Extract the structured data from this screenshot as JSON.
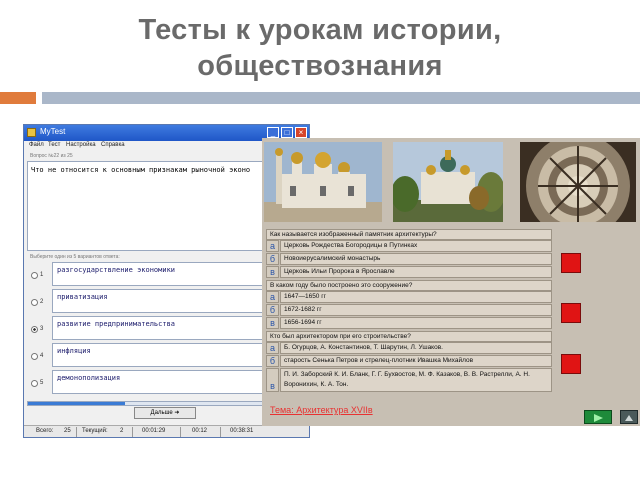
{
  "slide": {
    "title_line1": "Тесты к урокам истории,",
    "title_line2": "обществознания"
  },
  "mytest": {
    "window_title": "MyTest",
    "menu": [
      "Файл",
      "Тест",
      "Настройка",
      "Справка"
    ],
    "question_counter": "Вопрос №22 из 25",
    "question_text": "Что не относится к основным признакам рыночной эконо",
    "choose_prompt": "Выберите один из 5 вариантов ответа:",
    "answers": [
      {
        "num": "1",
        "text": "разгосударствление экономики"
      },
      {
        "num": "2",
        "text": "приватизация"
      },
      {
        "num": "3",
        "text": "развитие предпринимательства"
      },
      {
        "num": "4",
        "text": "инфляция"
      },
      {
        "num": "5",
        "text": "демонополизация"
      }
    ],
    "selected_answer": 3,
    "progress_fraction": 0.35,
    "next_button": "Дальше",
    "status": {
      "total_label": "Всего:",
      "total_value": "25",
      "current_label": "Текущий:",
      "current_value": "2",
      "time1": "00:01:29",
      "time2": "00:12",
      "time3": "00:38:31"
    }
  },
  "architecture_test": {
    "questions": [
      {
        "question": "Как называется изображенный памятник архитектуры?",
        "options": [
          {
            "letter": "а",
            "text": "Церковь Рождества Богородицы в Путинках"
          },
          {
            "letter": "б",
            "text": "Новоиерусалимский монастырь"
          },
          {
            "letter": "в",
            "text": "Церковь Ильи Пророка в Ярославле"
          }
        ]
      },
      {
        "question": "В каком году было построено это сооружение?",
        "options": [
          {
            "letter": "а",
            "text": "1647—1650 гг"
          },
          {
            "letter": "б",
            "text": "1672-1682 гг"
          },
          {
            "letter": "в",
            "text": "1656-1694 гг"
          }
        ]
      },
      {
        "question": "Кто был архитектором при его строительстве?",
        "options": [
          {
            "letter": "а",
            "text": "Б. Огурцов, А. Константинов, Т. Шарутин, Л. Ушаков."
          },
          {
            "letter": "б",
            "text": "старость Сенька Петров и стрелец-плотник Ивашка Михайлов"
          },
          {
            "letter": "в",
            "text": "П. И. Заборский К. И. Бланк, Г. Г. Бухвостов, М. Ф. Казаков, В. В. Растрелли, А. Н. Воронихин, К. А. Тон."
          }
        ]
      }
    ],
    "theme_link": "Тема: Архитектура XVIIв",
    "colors": {
      "panel_bg": "#c7bfb3",
      "cell_bg": "#ddd5c9",
      "red_button": "#e01414",
      "theme_text": "#e83232"
    }
  }
}
